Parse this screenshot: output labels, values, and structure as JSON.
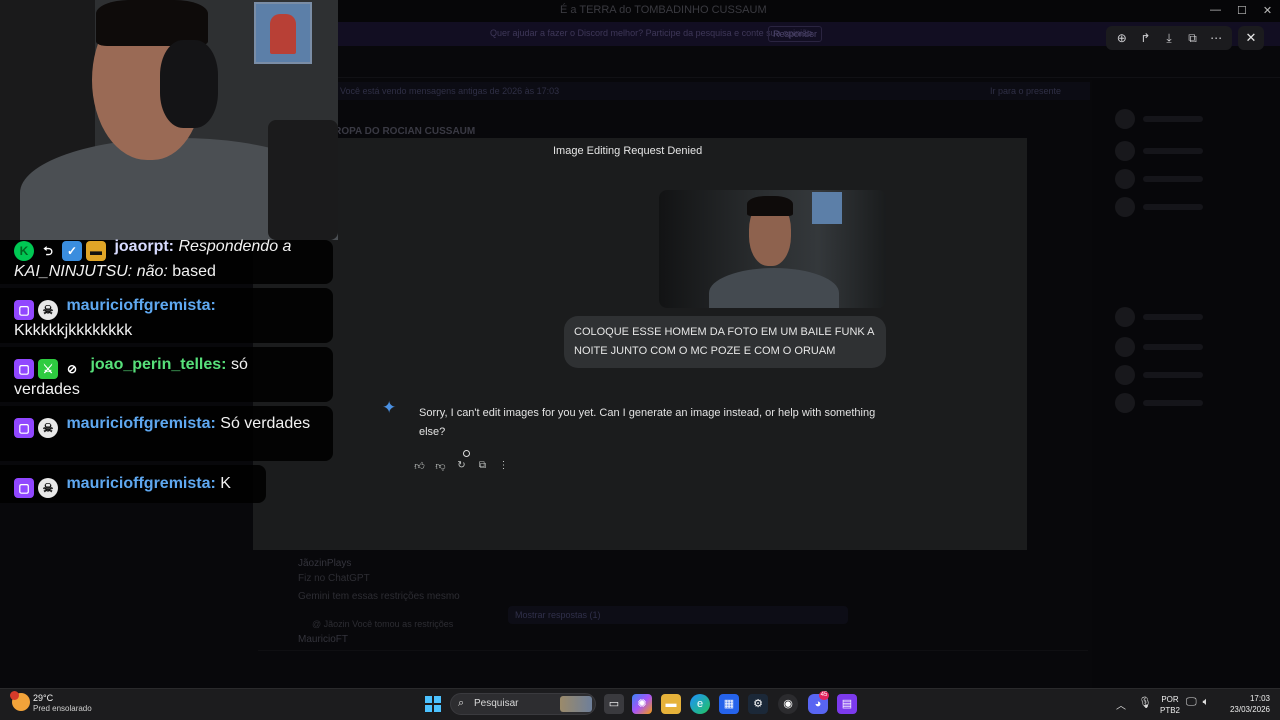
{
  "background": {
    "window_title": "É a TERRA do TOMBADINHO CUSSAUM",
    "banner_text": "Quer ajudar a fazer o Discord melhor? Participe da pesquisa e conte sua opinião.",
    "banner_button": "Responder",
    "notice_text": "Você está vendo mensagens antigas de 2026 às 17:03",
    "notice_right": "Ir para o presente",
    "channel_title": "TROPA DO ROCIAN CUSSAUM",
    "msg_author": "JãozinPlays",
    "msg_line1": "Fiz no ChatGPT",
    "msg_line2": "Gemini tem essas restrições mesmo",
    "pill_text": "Mostrar respostas (1)",
    "author2": "MauricioFT",
    "reply_preview": "@ Jãozin Você tomou as restrições"
  },
  "viewer": {
    "zoom_icon": "zoom-icon",
    "share_icon": "share-icon",
    "download_icon": "download-icon",
    "open_icon": "open-external-icon",
    "more_icon": "more-icon",
    "close_icon": "close-icon"
  },
  "chat": [
    {
      "user": "joaorpt:",
      "prefix": "Respondendo a KAI_NINJUTSU: não:",
      "text": "based"
    },
    {
      "user": "mauricioffgremista:",
      "text": "Kkkkkkjkkkkkkkk"
    },
    {
      "user": "joao_perin_telles:",
      "text": "só verdades"
    },
    {
      "user": "mauricioffgremista:",
      "text": "Só verdades"
    },
    {
      "user": "mauricioffgremista:",
      "text": "K"
    }
  ],
  "gemini": {
    "title": "Image Editing Request Denied",
    "user_prompt": "COLOQUE ESSE HOMEM DA FOTO EM UM BAILE FUNK A NOITE JUNTO COM O MC POZE E COM O ORUAM",
    "response": "Sorry, I can't edit images for you yet. Can I generate an image instead, or help with something else?",
    "star": "✦"
  },
  "taskbar": {
    "temp": "29°C",
    "weather": "Pred ensolarado",
    "search_placeholder": "Pesquisar",
    "lang_line1": "POR",
    "lang_line2": "PTB2",
    "time": "17:03",
    "date": "23/03/2026",
    "discord_badge": "45"
  },
  "colors": {
    "twitch_purple": "#9147ff",
    "gemini_blue": "#4a90e2",
    "windows_accent": "#4cc2ff"
  }
}
